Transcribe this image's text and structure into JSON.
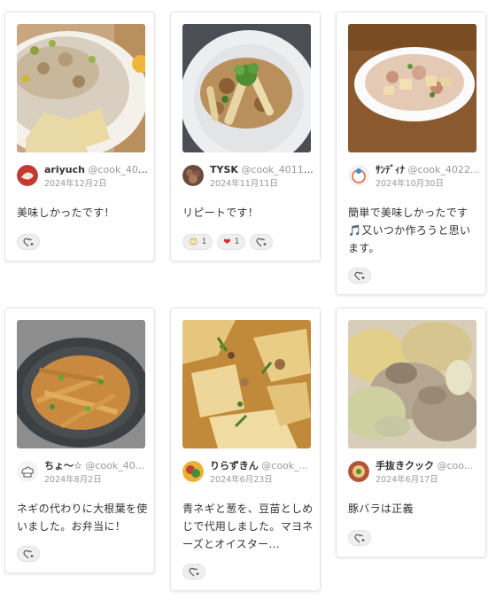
{
  "cards": [
    {
      "user_name": "ariyuch",
      "user_id": "@cook_400...",
      "date": "2024年12月2日",
      "comment": "美味しかったです！",
      "reactions": []
    },
    {
      "user_name": "TYSK",
      "user_id": "@cook_40110...",
      "date": "2024年11月11日",
      "comment": "リピートです！",
      "reactions": [
        {
          "emoji": "😊",
          "count": "1"
        },
        {
          "emoji": "❤",
          "count": "1"
        }
      ]
    },
    {
      "user_name": "ｻﾝﾃﾞｨﾅ",
      "user_id": "@cook_4022...",
      "date": "2024年10月30日",
      "comment": "簡単で美味しかったです🎵又いつか作ろうと思います。",
      "reactions": []
    },
    {
      "user_name": "ちょ〜☆",
      "user_id": "@cook_40...",
      "date": "2024年8月2日",
      "comment": "ネギの代わりに大根葉を使いました。お弁当に！",
      "reactions": []
    },
    {
      "user_name": "りらずきん",
      "user_id": "@cook_...",
      "date": "2024年6月23日",
      "comment": "青ネギと葱を、豆苗としめじで代用しました。マヨネーズとオイスター...",
      "reactions": []
    },
    {
      "user_name": "手抜きクック",
      "user_id": "@coo...",
      "date": "2024年6月17日",
      "comment": "豚バラは正義",
      "reactions": []
    }
  ],
  "icons": {
    "add_reaction": "heart-plus-icon"
  },
  "colors": {
    "heart": "#e02a2a",
    "card_border": "#e6e6e6",
    "date": "#999999"
  }
}
